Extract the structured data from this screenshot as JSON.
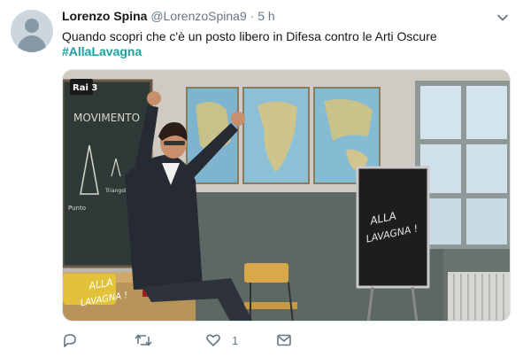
{
  "tweet": {
    "author_name": "Lorenzo Spina",
    "handle": "@LorenzoSpina9",
    "separator": "·",
    "time": "5 h",
    "text": "Quando scopri che c'è un posto libero in Difesa contro le Arti Oscure",
    "hashtag": "#AllaLavagna"
  },
  "media": {
    "channel_logo": "Rai 3",
    "chalkboard_text": "MOVIMENTO",
    "chalkboard_small_1": "Punto",
    "chalkboard_small_2": "Triangolo",
    "monitor_text_line1": "ALLA",
    "monitor_text_line2": "LAVAGNA !",
    "desk_logo_line1": "ALLA",
    "desk_logo_line2": "LAVAGNA !"
  },
  "actions": {
    "reply_icon": "reply-icon",
    "retweet_icon": "retweet-icon",
    "like_icon": "heart-icon",
    "like_count": "1",
    "message_icon": "envelope-icon"
  },
  "colors": {
    "accent": "#1da1a1",
    "secondary_text": "#657786"
  }
}
